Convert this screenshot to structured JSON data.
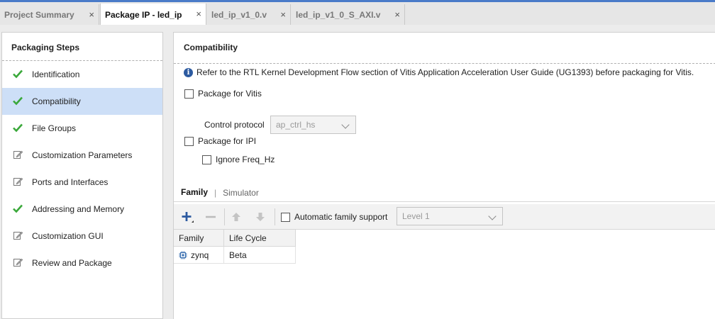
{
  "tabs": [
    {
      "label": "Project Summary",
      "active": false
    },
    {
      "label": "Package IP - led_ip",
      "active": true
    },
    {
      "label": "led_ip_v1_0.v",
      "active": false
    },
    {
      "label": "led_ip_v1_0_S_AXI.v",
      "active": false
    }
  ],
  "tab_close_glyph": "×",
  "left_panel": {
    "title": "Packaging Steps",
    "steps": [
      {
        "label": "Identification",
        "status": "complete",
        "icon": "check-icon"
      },
      {
        "label": "Compatibility",
        "status": "complete",
        "icon": "check-icon",
        "selected": true
      },
      {
        "label": "File Groups",
        "status": "complete",
        "icon": "check-icon"
      },
      {
        "label": "Customization Parameters",
        "status": "edited",
        "icon": "edit-icon"
      },
      {
        "label": "Ports and Interfaces",
        "status": "edited",
        "icon": "edit-icon"
      },
      {
        "label": "Addressing and Memory",
        "status": "complete",
        "icon": "check-icon"
      },
      {
        "label": "Customization GUI",
        "status": "edited",
        "icon": "edit-icon"
      },
      {
        "label": "Review and Package",
        "status": "edited",
        "icon": "edit-icon"
      }
    ]
  },
  "compatibility": {
    "title": "Compatibility",
    "info_text": "Refer to the RTL Kernel Development Flow section of Vitis Application Acceleration User Guide (UG1393) before packaging for Vitis.",
    "package_vitis_label": "Package for Vitis",
    "package_vitis_checked": false,
    "control_protocol_label": "Control protocol",
    "control_protocol_value": "ap_ctrl_hs",
    "package_ipi_label": "Package for IPI",
    "package_ipi_checked": false,
    "ignore_freq_label": "Ignore Freq_Hz",
    "ignore_freq_checked": false
  },
  "subtabs": {
    "family": "Family",
    "separator": "|",
    "simulator": "Simulator"
  },
  "toolbar": {
    "auto_family_label": "Automatic family support",
    "auto_family_checked": false,
    "level_value": "Level 1"
  },
  "table": {
    "headers": [
      "Family",
      "Life Cycle"
    ],
    "rows": [
      {
        "family": "zynq",
        "life_cycle": "Beta"
      }
    ]
  },
  "colors": {
    "accent": "#4a7bc8",
    "check_green": "#3aa83a",
    "selected_bg": "#cddff7",
    "add_blue": "#2c5aa0"
  }
}
